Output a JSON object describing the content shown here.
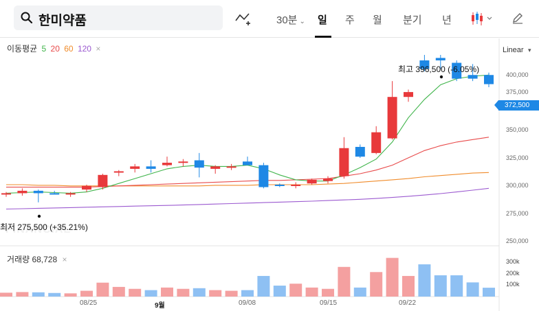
{
  "toolbar": {
    "search_value": "한미약품",
    "interval_label": "30분",
    "periods": [
      "일",
      "주",
      "월",
      "분기",
      "년"
    ],
    "active_period": "일"
  },
  "ma_legend": {
    "title": "이동평균",
    "periods": [
      "5",
      "20",
      "60",
      "120"
    ],
    "colors": [
      "#3fb44a",
      "#e84a4a",
      "#f08b2a",
      "#9b59d0"
    ]
  },
  "scale": {
    "label": "Linear"
  },
  "price_tag": "372,500",
  "annotations": {
    "high": "최고  396,500 (-6.05%)",
    "low": "최저  275,500 (+35.21%)"
  },
  "watermark": "FINANCIAL",
  "volume": {
    "label": "거래량 68,728"
  },
  "y_axis": [
    "400,000",
    "375,000",
    "350,000",
    "325,000",
    "300,000",
    "275,000",
    "250,000"
  ],
  "volume_axis": [
    "300k",
    "200k",
    "100k"
  ],
  "x_axis": [
    {
      "label": "08/25",
      "month": false
    },
    {
      "label": "9월",
      "month": true
    },
    {
      "label": "09/08",
      "month": false
    },
    {
      "label": "09/15",
      "month": false
    },
    {
      "label": "09/22",
      "month": false
    }
  ],
  "colors": {
    "up": "#e8393b",
    "down": "#1e88e5",
    "vol_up": "#f4a0a0",
    "vol_down": "#8ec0f3"
  },
  "chart_data": {
    "type": "candlestick",
    "y_range": [
      250000,
      410000
    ],
    "volume_range": [
      0,
      330000
    ],
    "candles": [
      {
        "o": 282000,
        "h": 284000,
        "l": 280000,
        "c": 283000,
        "v": 30000
      },
      {
        "o": 283000,
        "h": 287000,
        "l": 281000,
        "c": 285000,
        "v": 35000
      },
      {
        "o": 285000,
        "h": 286000,
        "l": 275500,
        "c": 283000,
        "v": 33000
      },
      {
        "o": 283000,
        "h": 285000,
        "l": 282000,
        "c": 282000,
        "v": 28000
      },
      {
        "o": 282000,
        "h": 284000,
        "l": 280000,
        "c": 283000,
        "v": 25000
      },
      {
        "o": 286000,
        "h": 290000,
        "l": 284000,
        "c": 289000,
        "v": 45000
      },
      {
        "o": 288000,
        "h": 299000,
        "l": 286000,
        "c": 298000,
        "v": 108000
      },
      {
        "o": 300000,
        "h": 302000,
        "l": 297000,
        "c": 301000,
        "v": 75000
      },
      {
        "o": 303000,
        "h": 307000,
        "l": 300000,
        "c": 305000,
        "v": 60000
      },
      {
        "o": 305000,
        "h": 310000,
        "l": 300000,
        "c": 303000,
        "v": 50000
      },
      {
        "o": 306000,
        "h": 313000,
        "l": 305000,
        "c": 308000,
        "v": 70000
      },
      {
        "o": 308000,
        "h": 311000,
        "l": 305000,
        "c": 309000,
        "v": 60000
      },
      {
        "o": 310000,
        "h": 316000,
        "l": 296000,
        "c": 304000,
        "v": 65000
      },
      {
        "o": 303000,
        "h": 306000,
        "l": 299000,
        "c": 305000,
        "v": 50000
      },
      {
        "o": 304000,
        "h": 307000,
        "l": 302000,
        "c": 305000,
        "v": 45000
      },
      {
        "o": 309000,
        "h": 313000,
        "l": 306000,
        "c": 306000,
        "v": 50000
      },
      {
        "o": 306000,
        "h": 308000,
        "l": 287000,
        "c": 288000,
        "v": 160000
      },
      {
        "o": 290000,
        "h": 291000,
        "l": 288000,
        "c": 289000,
        "v": 85000
      },
      {
        "o": 289000,
        "h": 292000,
        "l": 287000,
        "c": 290000,
        "v": 100000
      },
      {
        "o": 291000,
        "h": 295000,
        "l": 290000,
        "c": 294000,
        "v": 70000
      },
      {
        "o": 293000,
        "h": 297000,
        "l": 291000,
        "c": 295000,
        "v": 60000
      },
      {
        "o": 297000,
        "h": 329000,
        "l": 295000,
        "c": 320000,
        "v": 230000
      },
      {
        "o": 321000,
        "h": 323000,
        "l": 312000,
        "c": 313000,
        "v": 70000
      },
      {
        "o": 316000,
        "h": 338000,
        "l": 315000,
        "c": 333000,
        "v": 190000
      },
      {
        "o": 328000,
        "h": 375000,
        "l": 327000,
        "c": 362000,
        "v": 300000
      },
      {
        "o": 362000,
        "h": 368000,
        "l": 358000,
        "c": 366000,
        "v": 160000
      },
      {
        "o": 392000,
        "h": 396500,
        "l": 383000,
        "c": 385000,
        "v": 250000
      },
      {
        "o": 394000,
        "h": 396500,
        "l": 385000,
        "c": 392000,
        "v": 165000
      },
      {
        "o": 390000,
        "h": 392000,
        "l": 375000,
        "c": 377000,
        "v": 165000
      },
      {
        "o": 380000,
        "h": 389000,
        "l": 375000,
        "c": 377000,
        "v": 110000
      },
      {
        "o": 380000,
        "h": 382000,
        "l": 370000,
        "c": 372500,
        "v": 68728
      }
    ],
    "ma5": [
      283000,
      283500,
      284000,
      283500,
      283000,
      284000,
      287000,
      291000,
      295000,
      299000,
      303000,
      305000,
      306000,
      305000,
      305000,
      306000,
      303000,
      298000,
      294000,
      293000,
      293000,
      298000,
      304000,
      311000,
      325000,
      345000,
      360000,
      372000,
      377000,
      379000,
      380000
    ],
    "ma20": [
      288000,
      288000,
      288000,
      288000,
      288000,
      288000,
      288500,
      289000,
      289500,
      290000,
      290500,
      291000,
      291500,
      292000,
      292500,
      293000,
      293500,
      293500,
      294000,
      294500,
      295000,
      297000,
      299000,
      302000,
      306000,
      312000,
      318000,
      322000,
      325000,
      327000,
      329000
    ],
    "ma60": [
      290000,
      290000,
      289500,
      289500,
      289000,
      289000,
      289000,
      289000,
      289000,
      289000,
      289000,
      289000,
      289000,
      289500,
      289500,
      289500,
      290000,
      290000,
      290000,
      290000,
      290500,
      291000,
      292000,
      293000,
      294000,
      295000,
      296500,
      297500,
      298500,
      299500,
      300000
    ],
    "ma120": [
      270000,
      270300,
      270600,
      270900,
      271200,
      271500,
      271800,
      272100,
      272400,
      272700,
      273000,
      273300,
      273700,
      274100,
      274500,
      274900,
      275300,
      275700,
      276100,
      276500,
      277000,
      277500,
      278000,
      278700,
      279500,
      280500,
      281500,
      282700,
      284000,
      285500,
      287000
    ]
  }
}
